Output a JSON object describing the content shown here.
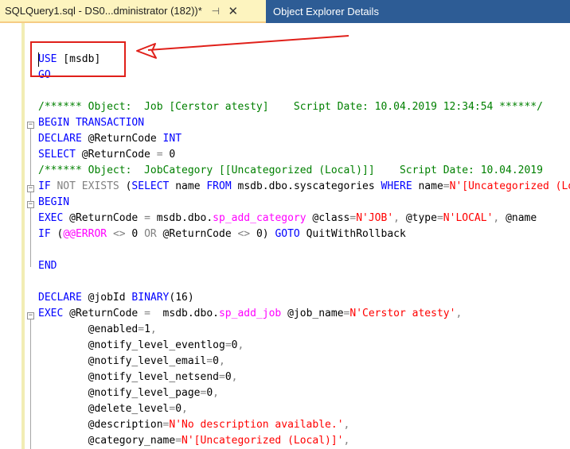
{
  "tabs": {
    "active_title": "SQLQuery1.sql - DS0...dministrator (182))*",
    "pin_glyph": "⊣",
    "close_glyph": "✕",
    "inactive_title": "Object Explorer Details"
  },
  "colors": {
    "tab_strip": "#2d5c95",
    "active_tab": "#fdf4bf",
    "keyword": "#0000ff",
    "string": "#ff0000",
    "comment": "#008000",
    "annotation": "#e0201a"
  },
  "editor": {
    "l1": {
      "a": "USE",
      "b": " [msdb]"
    },
    "l2": {
      "a": "GO"
    },
    "l4": {
      "a": "/****** Object:  Job [Cerstor atesty]    Script Date: 10.04.2019 12:34:54 ******/"
    },
    "l5": {
      "a": "BEGIN",
      "b": " ",
      "c": "TRANSACTION"
    },
    "l6": {
      "a": "DECLARE",
      "b": " @ReturnCode ",
      "c": "INT"
    },
    "l7": {
      "a": "SELECT",
      "b": " @ReturnCode ",
      "c": "=",
      "d": " 0"
    },
    "l8": {
      "a": "/****** Object:  JobCategory [[Uncategorized (Local)]]    Script Date: 10.04.2019"
    },
    "l9": {
      "a": "IF",
      "b": " ",
      "c": "NOT",
      "d": " ",
      "e": "EXISTS",
      "f": " (",
      "g": "SELECT",
      "h": " name ",
      "i": "FROM",
      "j": " msdb.dbo.syscategories ",
      "k": "WHERE",
      "l": " name",
      "m": "=",
      "n": "N'[Uncategorized (Local)]'"
    },
    "l10": {
      "a": "BEGIN"
    },
    "l11": {
      "a": "EXEC",
      "b": " @ReturnCode ",
      "c": "=",
      "d": " msdb.dbo.",
      "e": "sp_add_category",
      "f": " @class",
      "g": "=",
      "h": "N'JOB'",
      "i": ",",
      "j": " @type",
      "k": "=",
      "l": "N'LOCAL'",
      "m": ",",
      "n": " @name"
    },
    "l12": {
      "a": "IF",
      "b": " (",
      "c": "@@ERROR",
      "d": " ",
      "e": "<>",
      "f": " 0 ",
      "g": "OR",
      "h": " @ReturnCode ",
      "i": "<>",
      "j": " 0) ",
      "k": "GOTO",
      "l": " QuitWithRollback"
    },
    "l14": {
      "a": "END"
    },
    "l16": {
      "a": "DECLARE",
      "b": " @jobId ",
      "c": "BINARY",
      "d": "(16)"
    },
    "l17": {
      "a": "EXEC",
      "b": " @ReturnCode ",
      "c": "=",
      "d": "  msdb.dbo.",
      "e": "sp_add_job",
      "f": " @job_name",
      "g": "=",
      "h": "N'Cerstor atesty'",
      "i": ","
    },
    "l18": {
      "a": "        @enabled",
      "b": "=",
      "c": "1",
      "d": ","
    },
    "l19": {
      "a": "        @notify_level_eventlog",
      "b": "=",
      "c": "0",
      "d": ","
    },
    "l20": {
      "a": "        @notify_level_email",
      "b": "=",
      "c": "0",
      "d": ","
    },
    "l21": {
      "a": "        @notify_level_netsend",
      "b": "=",
      "c": "0",
      "d": ","
    },
    "l22": {
      "a": "        @notify_level_page",
      "b": "=",
      "c": "0",
      "d": ","
    },
    "l23": {
      "a": "        @delete_level",
      "b": "=",
      "c": "0",
      "d": ","
    },
    "l24": {
      "a": "        @description",
      "b": "=",
      "c": "N'No description available.'",
      "d": ","
    },
    "l25": {
      "a": "        @category_name",
      "b": "=",
      "c": "N'[Uncategorized (Local)]'",
      "d": ","
    }
  }
}
